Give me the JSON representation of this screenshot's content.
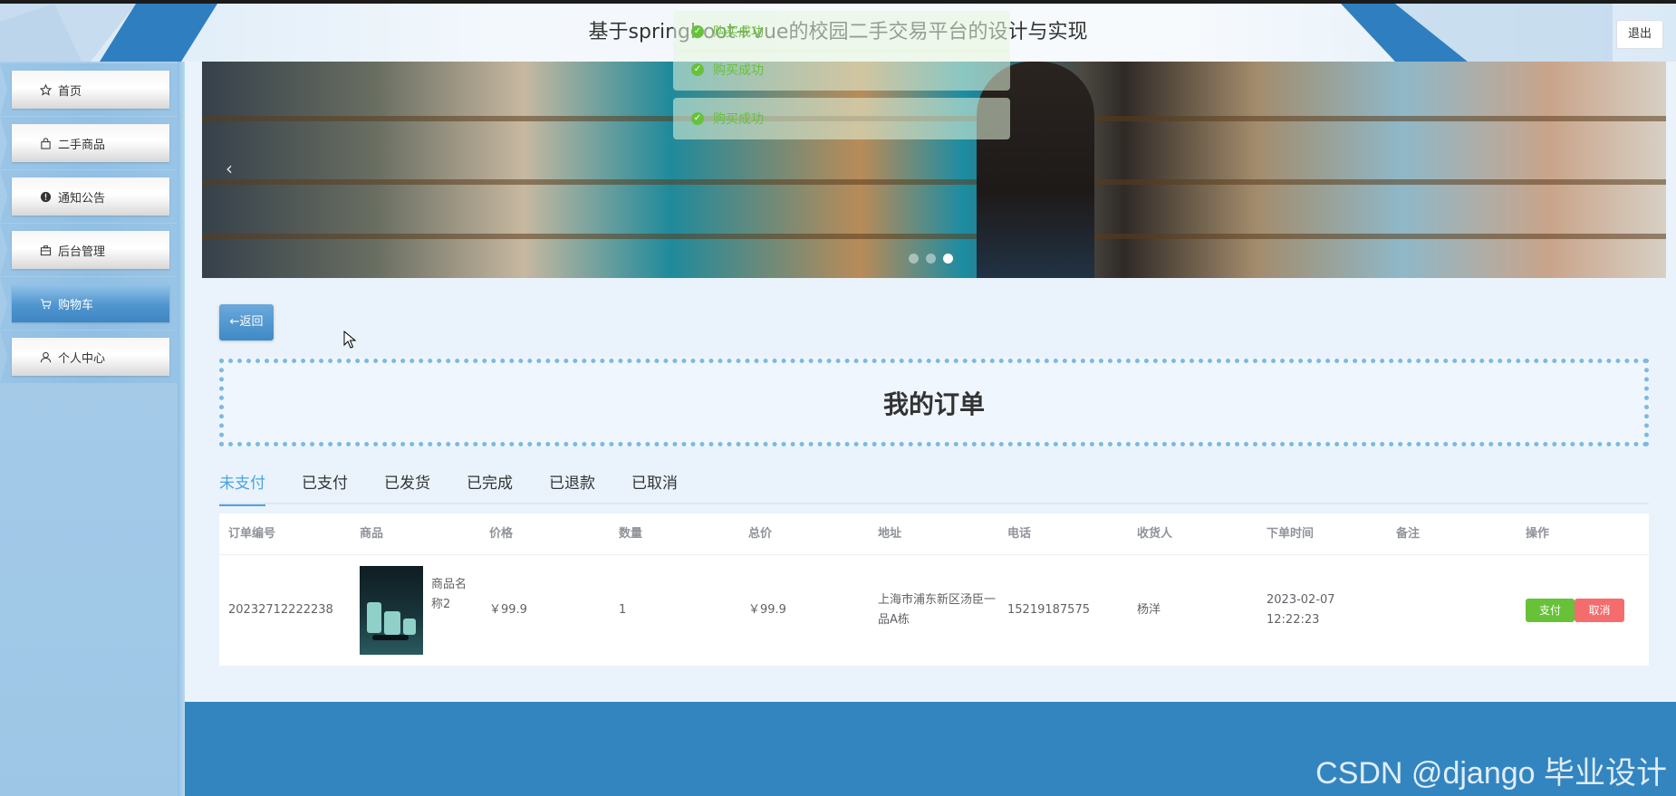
{
  "header": {
    "title": "基于springboot+vue的校园二手交易平台的设计与实现",
    "logout_label": "退出"
  },
  "sidebar": {
    "items": [
      {
        "label": "首页",
        "icon": "star-icon"
      },
      {
        "label": "二手商品",
        "icon": "bag-icon"
      },
      {
        "label": "通知公告",
        "icon": "info-icon"
      },
      {
        "label": "后台管理",
        "icon": "briefcase-icon"
      },
      {
        "label": "购物车",
        "icon": "cart-icon",
        "active": true
      },
      {
        "label": "个人中心",
        "icon": "user-icon"
      }
    ]
  },
  "toasts": [
    "购买成功",
    "购买成功",
    "购买成功"
  ],
  "main": {
    "back_label": "←返回",
    "page_title": "我的订单",
    "tabs": [
      "未支付",
      "已支付",
      "已发货",
      "已完成",
      "已退款",
      "已取消"
    ],
    "active_tab": "未支付",
    "columns": [
      "订单编号",
      "商品",
      "价格",
      "数量",
      "总价",
      "地址",
      "电话",
      "收货人",
      "下单时间",
      "备注",
      "操作"
    ],
    "rows": [
      {
        "order_no": "20232712222238",
        "product_name": "商品名称2",
        "price": "￥99.9",
        "quantity": "1",
        "total": "￥99.9",
        "address": "上海市浦东新区汤臣一品A栋",
        "phone": "15219187575",
        "receiver": "杨洋",
        "order_time": "2023-02-07 12:22:23",
        "remark": "",
        "pay_label": "支付",
        "cancel_label": "取消"
      }
    ]
  },
  "watermark": "CSDN @django 毕业设计",
  "colors": {
    "accent": "#4aa3df",
    "footer": "#3385c0",
    "pay": "#67c23a",
    "cancel": "#f56c6c"
  }
}
